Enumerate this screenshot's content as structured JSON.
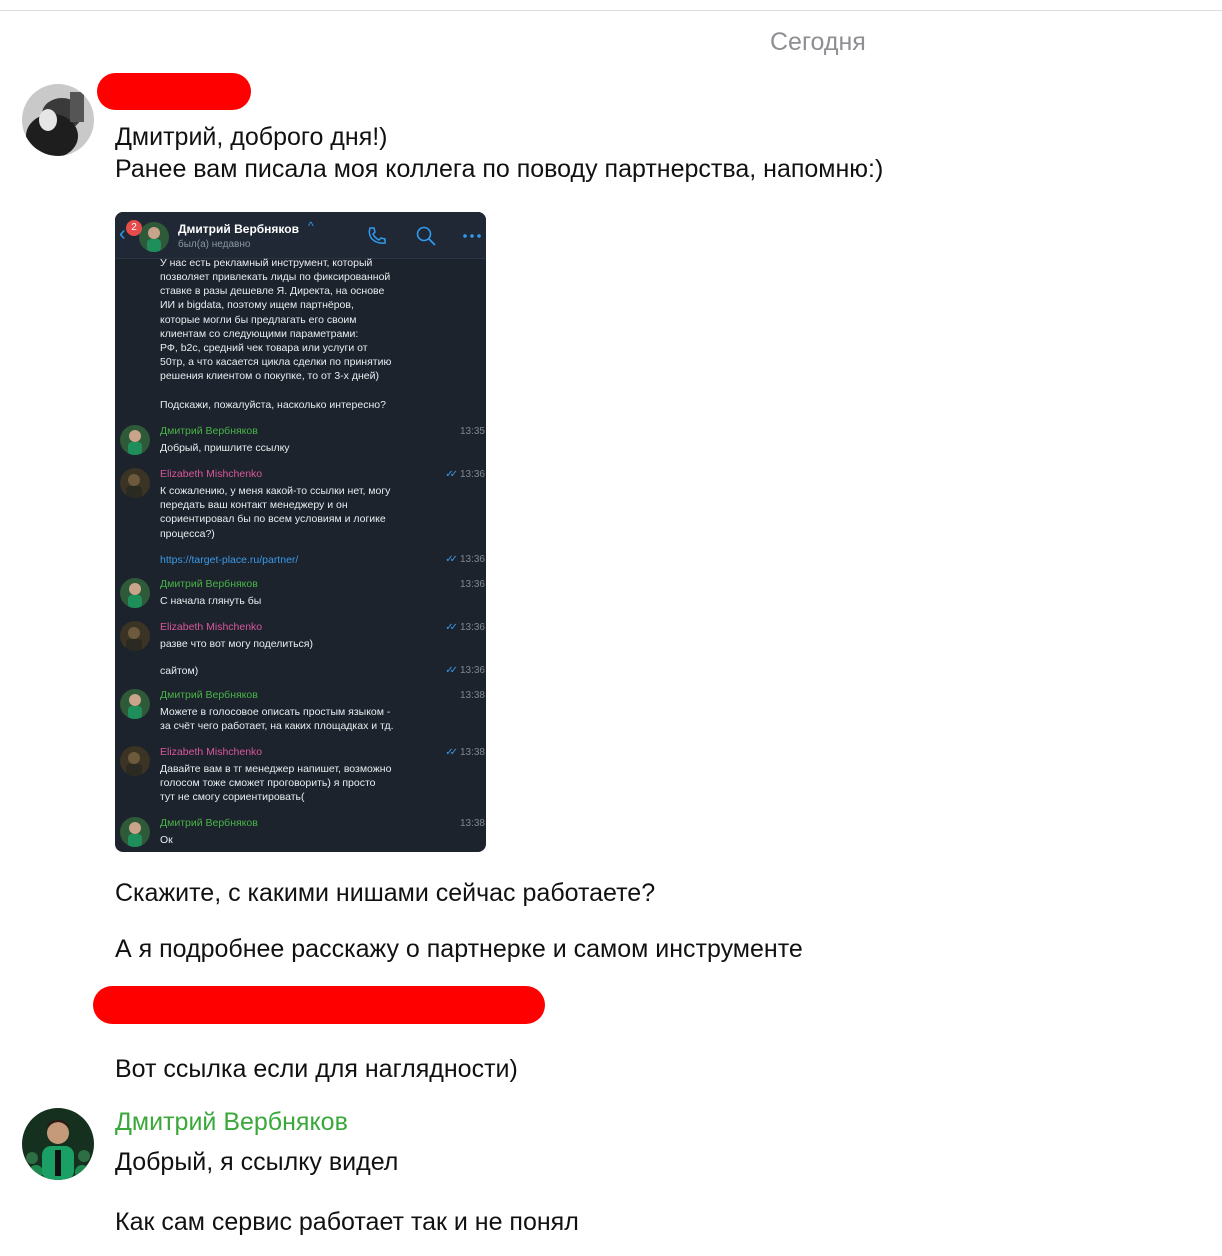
{
  "date_separator": "Сегодня",
  "message1": {
    "line1": "Дмитрий, доброго дня!)",
    "line2": "Ранее вам писала моя коллега по поводу партнерства, напомню:)"
  },
  "screenshot": {
    "badge_count": "2",
    "contact_name": "Дмитрий Вербняков",
    "contact_status": "был(а) недавно",
    "intro_lines": [
      "У нас есть рекламный инструмент, который",
      "позволяет привлекать лиды по фиксированной",
      "ставке в разы дешевле Я. Директа, на основе",
      "ИИ и bigdata, поэтому ищем партнёров,",
      "которые могли бы предлагать его своим",
      "клиентам со следующими параметрами:",
      "РФ, b2c, средний чек товара или услуги от",
      "50тр, а что касается цикла сделки по принятию",
      "решения клиентом о покупке, то от 3-х дней)",
      "",
      "Подскажи, пожалуйста, насколько интересно?"
    ],
    "messages": [
      {
        "name": "Дмитрий Вербняков",
        "time": "13:35",
        "lines": [
          "Добрый, пришлите ссылку"
        ]
      },
      {
        "name": "Elizabeth Mishchenko",
        "time": "13:36",
        "lines": [
          "К сожалению, у меня какой-то ссылки нет, могу",
          "передать ваш контакт менеджеру и он",
          "сориентировал бы по всем условиям и логике",
          "процесса?)"
        ]
      },
      {
        "time": "13:36",
        "lines": [
          "https://target-place.ru/partner/"
        ]
      },
      {
        "name": "Дмитрий Вербняков",
        "time": "13:36",
        "lines": [
          "С начала глянуть бы"
        ]
      },
      {
        "name": "Elizabeth Mishchenko",
        "time": "13:36",
        "lines": [
          "разве что вот могу поделиться)"
        ]
      },
      {
        "time": "13:36",
        "lines": [
          "сайтом)"
        ]
      },
      {
        "name": "Дмитрий Вербняков",
        "time": "13:38",
        "lines": [
          "Можете в голосовое описать простым языком -",
          "за счёт чего работает, на каких площадках и тд."
        ]
      },
      {
        "name": "Elizabeth Mishchenko",
        "time": "13:38",
        "lines": [
          "Давайте вам в тг менеджер напишет, возможно",
          "голосом тоже сможет проговорить) я просто",
          "тут не смогу сориентировать("
        ]
      },
      {
        "name": "Дмитрий Вербняков",
        "time": "13:38",
        "lines": [
          "Ок"
        ]
      }
    ]
  },
  "message2": "Скажите, с какими нишами сейчас работаете?",
  "message3": "А я подробнее расскажу о партнерке и самом инструменте",
  "message4": "Вот ссылка если для наглядности)",
  "reply": {
    "sender": "Дмитрий Вербняков",
    "line1": "Добрый, я ссылку видел",
    "line2": "Как сам сервис работает так и не понял"
  },
  "colors": {
    "sender_green": "#3aa83a",
    "redaction": "#ff0000",
    "screenshot_bg": "#1c232d",
    "accent_blue": "#2e9cf0"
  }
}
